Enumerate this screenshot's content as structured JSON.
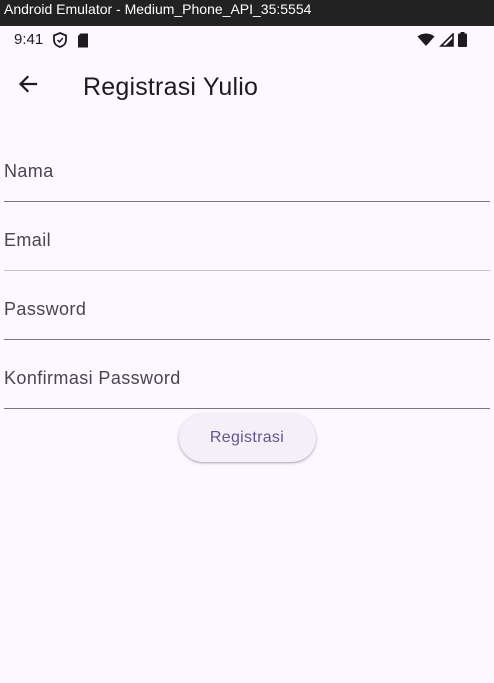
{
  "window": {
    "title": "Android Emulator - Medium_Phone_API_35:5554"
  },
  "status_bar": {
    "time": "9:41",
    "left_icons": [
      "shield-icon",
      "sd-card-icon"
    ],
    "right_icons": [
      "wifi-icon",
      "signal-icon",
      "battery-icon"
    ]
  },
  "app_bar": {
    "back_icon": "arrow-left-icon",
    "title": "Registrasi Yulio"
  },
  "form": {
    "fields": [
      {
        "name": "nama",
        "placeholder": "Nama",
        "value": ""
      },
      {
        "name": "email",
        "placeholder": "Email",
        "value": ""
      },
      {
        "name": "password",
        "placeholder": "Password",
        "value": ""
      },
      {
        "name": "konfirmasi-password",
        "placeholder": "Konfirmasi Password",
        "value": ""
      }
    ],
    "submit_label": "Registrasi"
  },
  "colors": {
    "background": "#fdf7ff",
    "text": "#1d1b20",
    "accent": "#65558f",
    "button_bg": "#f5eff7"
  }
}
